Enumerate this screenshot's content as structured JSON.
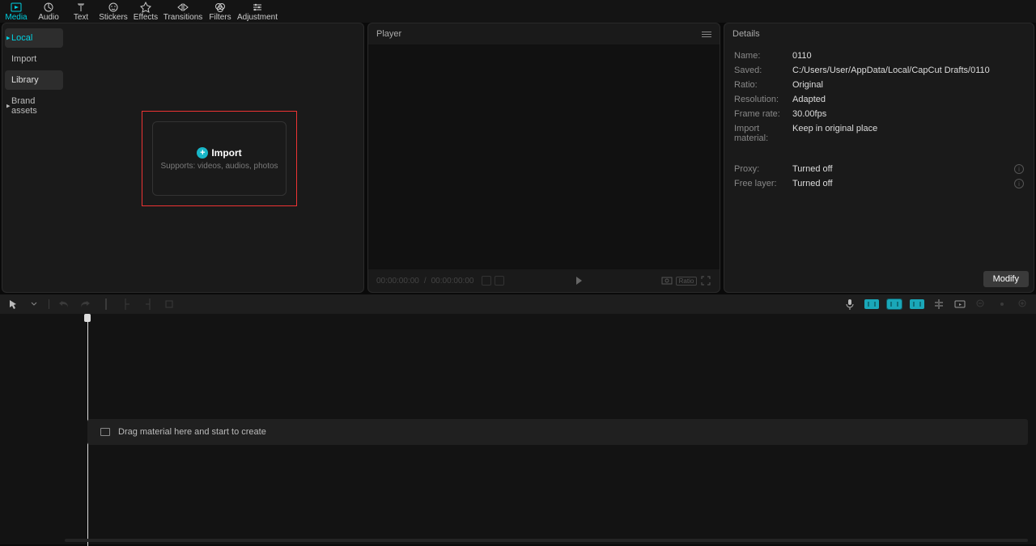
{
  "top_tabs": [
    {
      "name": "media",
      "label": "Media",
      "active": true
    },
    {
      "name": "audio",
      "label": "Audio"
    },
    {
      "name": "text",
      "label": "Text"
    },
    {
      "name": "stickers",
      "label": "Stickers"
    },
    {
      "name": "effects",
      "label": "Effects"
    },
    {
      "name": "transitions",
      "label": "Transitions",
      "wide": true
    },
    {
      "name": "filters",
      "label": "Filters"
    },
    {
      "name": "adjustment",
      "label": "Adjustment",
      "wide": true
    }
  ],
  "sidebar": {
    "items": [
      {
        "name": "local",
        "label": "Local",
        "active": true,
        "dot": true
      },
      {
        "name": "import",
        "label": "Import"
      },
      {
        "name": "library",
        "label": "Library",
        "hover": true
      },
      {
        "name": "brand-assets",
        "label": "Brand assets",
        "dot": true
      }
    ]
  },
  "import_zone": {
    "title": "Import",
    "subtitle": "Supports: videos, audios, photos"
  },
  "player": {
    "title": "Player",
    "time_current": "00:00:00:00",
    "time_total": "00:00:00:00",
    "ratio_label": "Ratio"
  },
  "details": {
    "title": "Details",
    "rows": [
      {
        "k": "Name:",
        "v": "0110"
      },
      {
        "k": "Saved:",
        "v": "C:/Users/User/AppData/Local/CapCut Drafts/0110"
      },
      {
        "k": "Ratio:",
        "v": "Original"
      },
      {
        "k": "Resolution:",
        "v": "Adapted"
      },
      {
        "k": "Frame rate:",
        "v": "30.00fps"
      },
      {
        "k": "Import material:",
        "v": "Keep in original place"
      }
    ],
    "extra_rows": [
      {
        "k": "Proxy:",
        "v": "Turned off",
        "info": true
      },
      {
        "k": "Free layer:",
        "v": "Turned off",
        "info": true
      }
    ],
    "modify_label": "Modify"
  },
  "timeline": {
    "hint": "Drag material here and start to create"
  }
}
